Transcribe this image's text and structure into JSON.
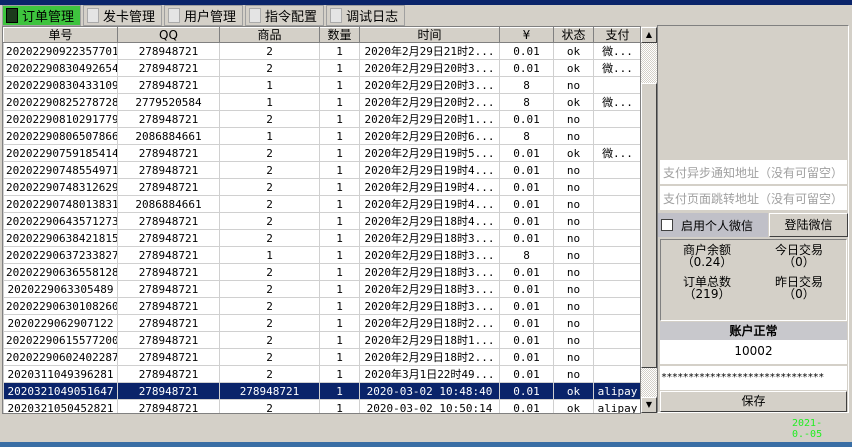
{
  "tabs": [
    {
      "label": "订单管理",
      "active": true
    },
    {
      "label": "发卡管理"
    },
    {
      "label": "用户管理"
    },
    {
      "label": "指令配置"
    },
    {
      "label": "调试日志"
    }
  ],
  "table": {
    "columns": [
      "单号",
      "QQ",
      "商品",
      "数量",
      "时间",
      "¥",
      "状态",
      "支付"
    ],
    "rows": [
      [
        "20202290922357701",
        "278948721",
        "2",
        "1",
        "2020年2月29日21时2...",
        "0.01",
        "ok",
        "微..."
      ],
      [
        "20202290830492654",
        "278948721",
        "2",
        "1",
        "2020年2月29日20时3...",
        "0.01",
        "ok",
        "微..."
      ],
      [
        "20202290830433109",
        "278948721",
        "1",
        "1",
        "2020年2月29日20时3...",
        "8",
        "no",
        ""
      ],
      [
        "20202290825278728",
        "2779520584",
        "1",
        "1",
        "2020年2月29日20时2...",
        "8",
        "ok",
        "微..."
      ],
      [
        "20202290810291779",
        "278948721",
        "2",
        "1",
        "2020年2月29日20时1...",
        "0.01",
        "no",
        ""
      ],
      [
        "20202290806507866",
        "2086884661",
        "1",
        "1",
        "2020年2月29日20时6...",
        "8",
        "no",
        ""
      ],
      [
        "20202290759185414",
        "278948721",
        "2",
        "1",
        "2020年2月29日19时5...",
        "0.01",
        "ok",
        "微..."
      ],
      [
        "20202290748554971",
        "278948721",
        "2",
        "1",
        "2020年2月29日19时4...",
        "0.01",
        "no",
        ""
      ],
      [
        "20202290748312629",
        "278948721",
        "2",
        "1",
        "2020年2月29日19时4...",
        "0.01",
        "no",
        ""
      ],
      [
        "20202290748013831",
        "2086884661",
        "2",
        "1",
        "2020年2月29日19时4...",
        "0.01",
        "no",
        ""
      ],
      [
        "20202290643571273",
        "278948721",
        "2",
        "1",
        "2020年2月29日18时4...",
        "0.01",
        "no",
        ""
      ],
      [
        "20202290638421815",
        "278948721",
        "2",
        "1",
        "2020年2月29日18时3...",
        "0.01",
        "no",
        ""
      ],
      [
        "20202290637233827",
        "278948721",
        "1",
        "1",
        "2020年2月29日18时3...",
        "8",
        "no",
        ""
      ],
      [
        "20202290636558128",
        "278948721",
        "2",
        "1",
        "2020年2月29日18时3...",
        "0.01",
        "no",
        ""
      ],
      [
        "2020229063305489",
        "278948721",
        "2",
        "1",
        "2020年2月29日18时3...",
        "0.01",
        "no",
        ""
      ],
      [
        "20202290630108260",
        "278948721",
        "2",
        "1",
        "2020年2月29日18时3...",
        "0.01",
        "no",
        ""
      ],
      [
        "2020229062907122",
        "278948721",
        "2",
        "1",
        "2020年2月29日18时2...",
        "0.01",
        "no",
        ""
      ],
      [
        "20202290615577200",
        "278948721",
        "2",
        "1",
        "2020年2月29日18时1...",
        "0.01",
        "no",
        ""
      ],
      [
        "20202290602402287",
        "278948721",
        "2",
        "1",
        "2020年2月29日18时2...",
        "0.01",
        "no",
        ""
      ],
      [
        "2020311049396281",
        "278948721",
        "2",
        "1",
        "2020年3月1日22时49...",
        "0.01",
        "no",
        ""
      ],
      [
        "2020321049051647",
        "278948721",
        "278948721",
        "1",
        "2020-03-02 10:48:40",
        "0.01",
        "ok",
        "alipay"
      ],
      [
        "2020321050452821",
        "278948721",
        "2",
        "1",
        "2020-03-02 10:50:14",
        "0.01",
        "ok",
        "alipay"
      ]
    ],
    "selected_row": 20
  },
  "panel": {
    "notify_placeholder": "支付异步通知地址（没有可留空）",
    "return_placeholder": "支付页面跳转地址（没有可留空）",
    "wechat_checkbox": "启用个人微信",
    "wechat_checked": false,
    "login_wechat": "登陆微信",
    "stats": {
      "balance_label": "商户余额",
      "balance": "（0.24）",
      "today_label": "今日交易",
      "today": "（0）",
      "orders_label": "订单总数",
      "orders": "（219）",
      "yesterday_label": "昨日交易",
      "yesterday": "（0）"
    },
    "account_status": "账户正常",
    "account_id": "10002",
    "password": "******************************",
    "save": "保存"
  },
  "date_text": "2021-0.-05"
}
